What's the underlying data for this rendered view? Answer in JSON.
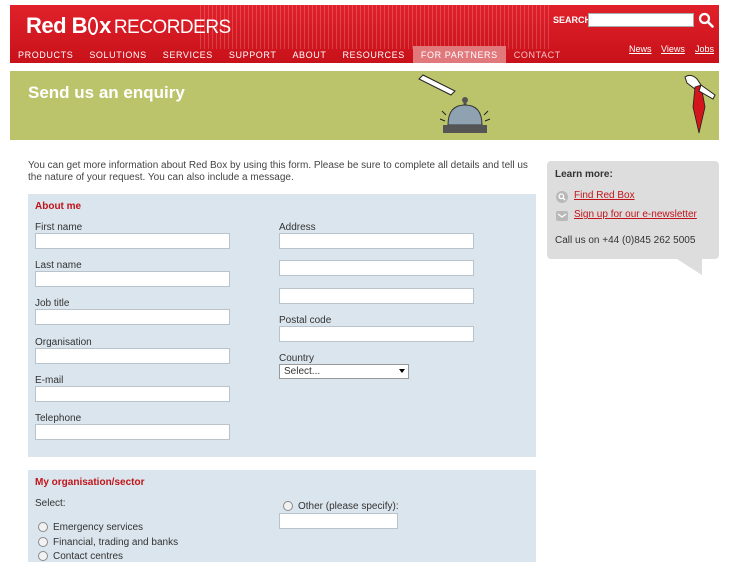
{
  "header": {
    "logo_main": "Red B",
    "logo_box_end": "x",
    "logo_sub": "RECORDERS",
    "search_label": "SEARCH",
    "search_value": ""
  },
  "nav": {
    "items": [
      "PRODUCTS",
      "SOLUTIONS",
      "SERVICES",
      "SUPPORT",
      "ABOUT",
      "RESOURCES",
      "FOR PARTNERS",
      "CONTACT"
    ],
    "active": "FOR PARTNERS"
  },
  "util_links": [
    "News",
    "Views",
    "Jobs"
  ],
  "banner": {
    "title": "Send us an enquiry"
  },
  "intro": "You can get more information about Red Box by using this form. Please be sure to complete all details and tell us the nature of your request. You can also include a message.",
  "about": {
    "title": "About me",
    "first_name_label": "First name",
    "last_name_label": "Last name",
    "job_title_label": "Job title",
    "organisation_label": "Organisation",
    "email_label": "E-mail",
    "telephone_label": "Telephone",
    "address_label": "Address",
    "postal_code_label": "Postal code",
    "country_label": "Country",
    "country_value": "Select..."
  },
  "org": {
    "title": "My organisation/sector",
    "select_label": "Select:",
    "options": [
      "Emergency services",
      "Financial, trading and banks",
      "Contact centres"
    ],
    "other_label": "Other (please specify):"
  },
  "sidebar": {
    "title": "Learn more:",
    "find_link": "Find Red Box",
    "newsletter_link": "Sign up for our e-newsletter",
    "call_text": "Call us on +44 (0)845 262 5005"
  },
  "colors": {
    "brand_red": "#d4151c",
    "banner_green": "#bcc46b",
    "form_panel": "#dbe5ed",
    "sidebar_grey": "#dddddd"
  }
}
